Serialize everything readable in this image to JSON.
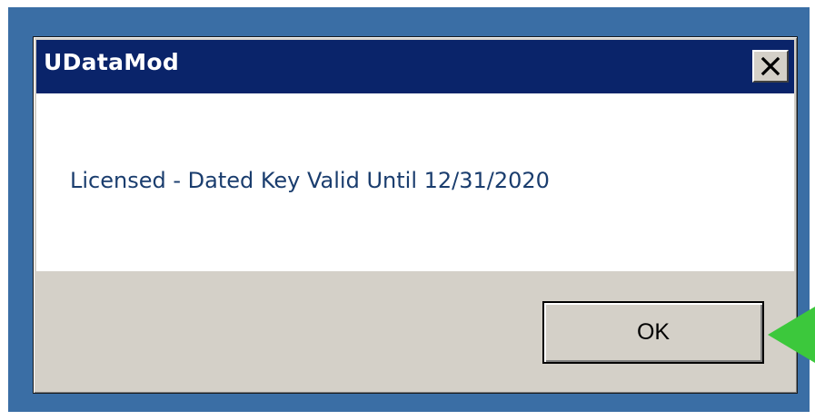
{
  "dialog": {
    "title": "UDataMod",
    "message": "Licensed - Dated Key Valid Until 12/31/2020",
    "ok_label": "OK"
  },
  "icons": {
    "close": "close-x-icon",
    "pointer": "green-arrow-pointer-icon"
  },
  "colors": {
    "titlebar": "#0a246a",
    "desktop": "#3a6ea5",
    "dialog_face": "#d4d0c8",
    "message_text": "#1a3d6e",
    "arrow": "#3cc83c"
  }
}
